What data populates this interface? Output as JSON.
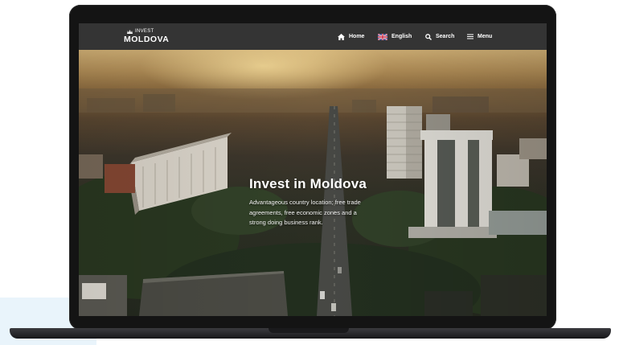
{
  "nav": {
    "logo_small": "INVEST",
    "logo_big": "MOLDOVA",
    "items": [
      {
        "label": "Home",
        "icon": "home-icon"
      },
      {
        "label": "English",
        "icon": "uk-flag-icon"
      },
      {
        "label": "Search",
        "icon": "search-icon"
      },
      {
        "label": "Menu",
        "icon": "menu-icon"
      }
    ]
  },
  "hero": {
    "title": "Invest in Moldova",
    "text": "Advantageous country location; free trade agreements, free economic zones and a strong doing business rank."
  },
  "colors": {
    "navbar": "#343434",
    "device": "#141414",
    "accent_bg": "#e9f4fb"
  }
}
